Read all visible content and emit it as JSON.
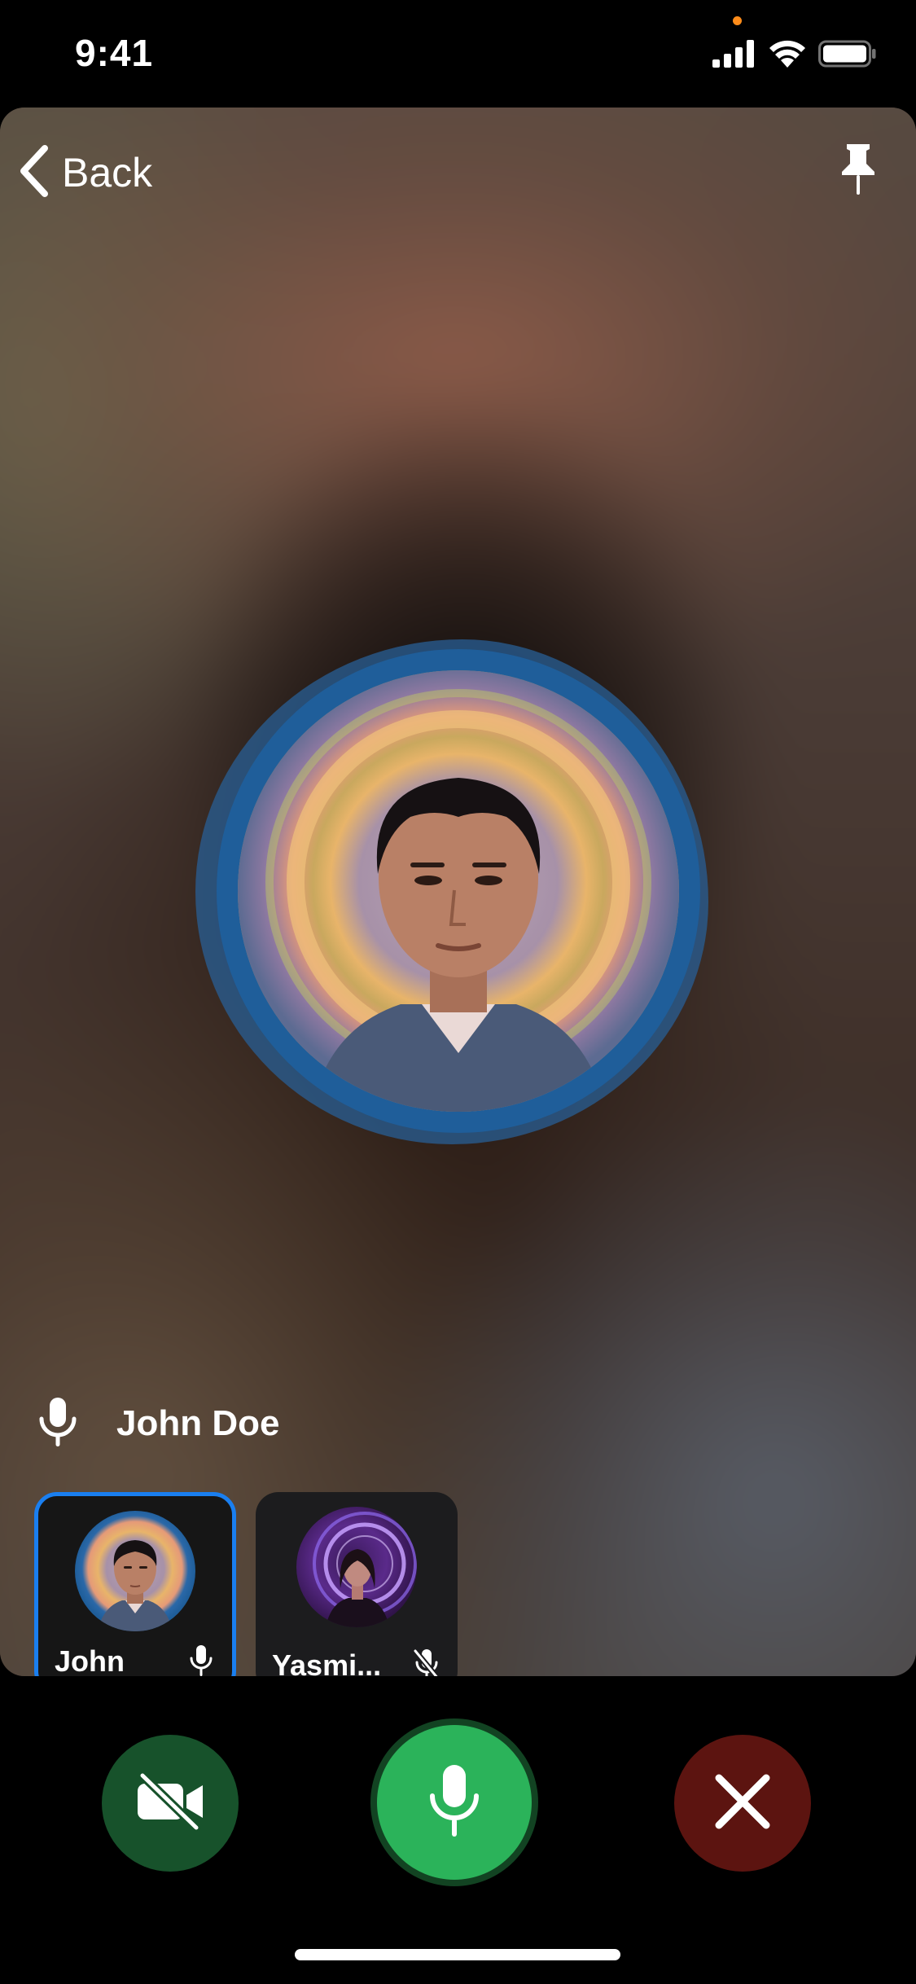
{
  "status_bar": {
    "time": "9:41"
  },
  "header": {
    "back_label": "Back"
  },
  "speaker": {
    "name": "John Doe"
  },
  "participants": [
    {
      "name": "John",
      "mic": "on",
      "active": true
    },
    {
      "name": "Yasmi...",
      "mic": "muted",
      "active": false
    }
  ],
  "controls": {
    "camera": "off",
    "microphone": "on"
  },
  "colors": {
    "accent_blue": "#1a7ff0",
    "mic_on_green": "#2bb35a",
    "camera_off_green": "#17522b",
    "end_call_red": "#5c1410",
    "tile_background": "#1c1c1e",
    "privacy_indicator": "#ff8c1a"
  },
  "icons": {
    "status": [
      "cellular-signal-icon",
      "wifi-icon",
      "battery-icon"
    ],
    "header": [
      "chevron-left-icon",
      "pin-icon"
    ],
    "controls": [
      "video-off-icon",
      "microphone-icon",
      "close-icon"
    ]
  }
}
